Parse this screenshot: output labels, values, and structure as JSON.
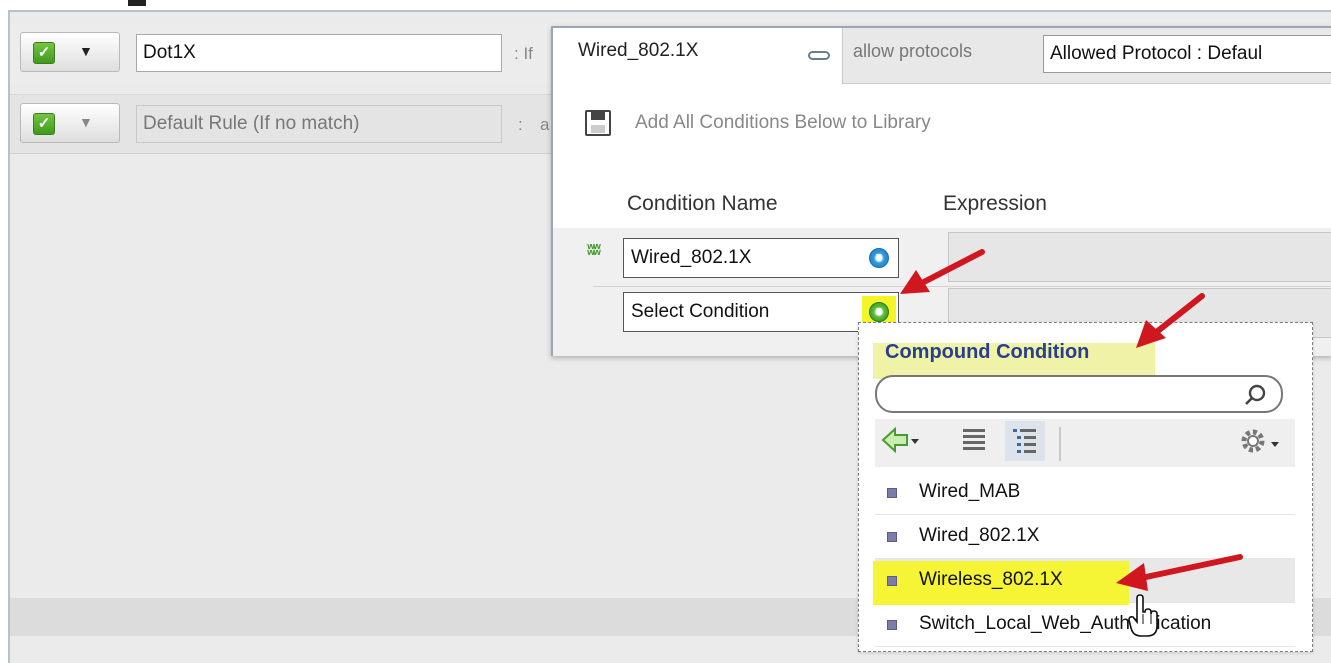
{
  "rules": [
    {
      "name": "Dot1X",
      "if_label": ": If"
    },
    {
      "name": "Default Rule (If no match)",
      "separator": ":",
      "next_char": "a"
    }
  ],
  "popup": {
    "tab_label": "Wired_802.1X",
    "allow_label": "allow protocols",
    "protocol_value": "Allowed Protocol : Defaul",
    "library_text": "Add All Conditions Below to Library",
    "columns": {
      "name": "Condition Name",
      "expression": "Expression"
    },
    "conditions": [
      {
        "value": "Wired_802.1X"
      },
      {
        "value": "Select Condition"
      }
    ]
  },
  "dropdown": {
    "header": "Compound Condition",
    "search_value": "",
    "items": [
      "Wired_MAB",
      "Wired_802.1X",
      "Wireless_802.1X",
      "Switch_Local_Web_Authentication"
    ]
  },
  "colors": {
    "highlight": "#f5f536",
    "annotation_arrow": "#d0161e",
    "checkbox_green": "#4fae29"
  }
}
